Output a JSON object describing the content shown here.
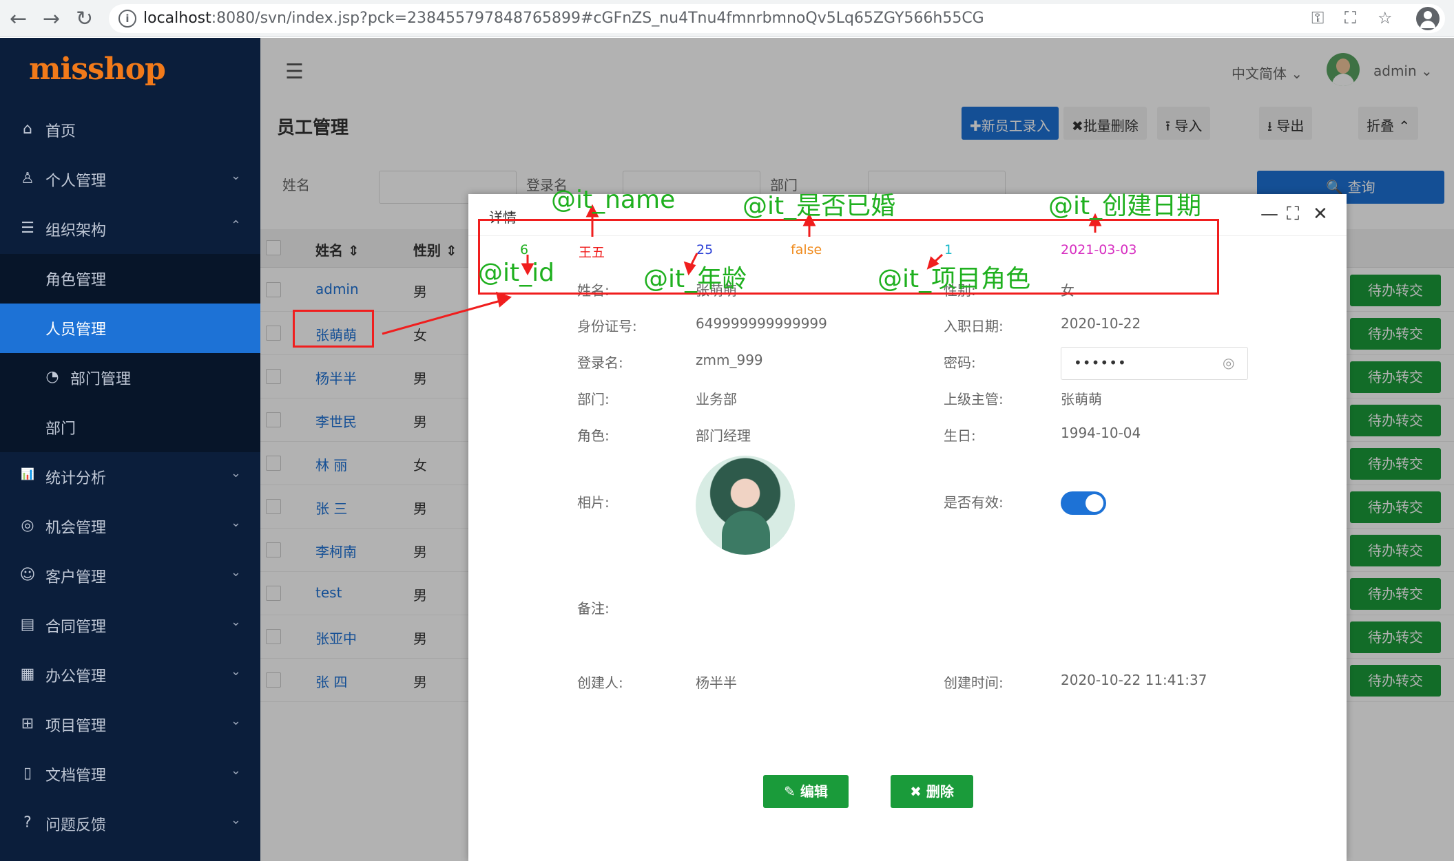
{
  "browser": {
    "url_host": "localhost",
    "url_rest": ":8080/svn/index.jsp?pck=2384557978487658​99#cGFnZS_nu4Tnu4fmnrbmnoQv5Lq65ZGY566h55CG"
  },
  "app": {
    "logo": "misshop"
  },
  "sidebar": {
    "items": [
      {
        "label": "首页",
        "icon": "home-icon",
        "ic": "⌂"
      },
      {
        "label": "个人管理",
        "icon": "user-icon",
        "ic": "♙",
        "chev": "⌄"
      },
      {
        "label": "组织架构",
        "icon": "menu-icon",
        "ic": "☰",
        "chev": "⌃"
      },
      {
        "label": "角色管理"
      },
      {
        "label": "人员管理"
      },
      {
        "label": "部门管理",
        "icon": "pie-icon",
        "ic": "◔"
      },
      {
        "label": "部门"
      },
      {
        "label": "统计分析",
        "icon": "chart-icon",
        "ic": "📊",
        "chev": "⌄"
      },
      {
        "label": "机会管理",
        "icon": "opportunity-icon",
        "ic": "◎",
        "chev": "⌄"
      },
      {
        "label": "客户管理",
        "icon": "customer-icon",
        "ic": "☺",
        "chev": "⌄"
      },
      {
        "label": "合同管理",
        "icon": "contract-icon",
        "ic": "▤",
        "chev": "⌄"
      },
      {
        "label": "办公管理",
        "icon": "calendar-icon",
        "ic": "▦",
        "chev": "⌄"
      },
      {
        "label": "项目管理",
        "icon": "project-icon",
        "ic": "⊞",
        "chev": "⌄"
      },
      {
        "label": "文档管理",
        "icon": "document-icon",
        "ic": "▯",
        "chev": "⌄"
      },
      {
        "label": "问题反馈",
        "icon": "question-icon",
        "ic": "?",
        "chev": "⌄"
      }
    ]
  },
  "topbar": {
    "language": "中文简体 ⌄",
    "username": "admin ⌄"
  },
  "page": {
    "title": "员工管理",
    "buttons": {
      "new": "✚新员工录入",
      "batch_delete": "✖批量删除",
      "import": "⭱ 导入",
      "export": "⭳ 导出",
      "collapse": "折叠 ⌃"
    }
  },
  "filters": {
    "name_label": "姓名",
    "login_label": "登录名",
    "dept_label": "部门",
    "query_button": "🔍 查询"
  },
  "table": {
    "headers": {
      "name": "姓名 ⇕",
      "sex": "性别 ⇕"
    },
    "rows": [
      {
        "name": "admin",
        "sex": "男",
        "action": "待办转交"
      },
      {
        "name": "张萌萌",
        "sex": "女",
        "action": "待办转交"
      },
      {
        "name": "杨半半",
        "sex": "男",
        "action": "待办转交"
      },
      {
        "name": "李世民",
        "sex": "男",
        "action": "待办转交"
      },
      {
        "name": "林 丽",
        "sex": "女",
        "action": "待办转交"
      },
      {
        "name": "张 三",
        "sex": "男",
        "action": "待办转交"
      },
      {
        "name": "李柯南",
        "sex": "男",
        "action": "待办转交"
      },
      {
        "name": "test",
        "sex": "男",
        "action": "待办转交"
      },
      {
        "name": "张亚中",
        "sex": "男",
        "action": "待办转交"
      },
      {
        "name": "张 四",
        "sex": "男",
        "action": "待办转交"
      }
    ]
  },
  "dialog": {
    "title": "详情",
    "it_values": {
      "id": "6",
      "name": "王五",
      "age": "25",
      "married": "false",
      "role": "1",
      "created_date": "2021-03-03"
    },
    "fields": {
      "name_label": "姓名:",
      "name_value": "张萌萌",
      "sex_label": "性别:",
      "sex_value": "女",
      "idcard_label": "身份证号:",
      "idcard_value": "649999999999999",
      "hire_label": "入职日期:",
      "hire_value": "2020-10-22",
      "login_label": "登录名:",
      "login_value": "zmm_999",
      "password_label": "密码:",
      "password_value": "••••••",
      "dept_label": "部门:",
      "dept_value": "业务部",
      "manager_label": "上级主管:",
      "manager_value": "张萌萌",
      "role_label": "角色:",
      "role_value": "部门经理",
      "birthday_label": "生日:",
      "birthday_value": "1994-10-04",
      "photo_label": "相片:",
      "valid_label": "是否有效:",
      "remark_label": "备注:",
      "creator_label": "创建人:",
      "creator_value": "杨半半",
      "created_label": "创建时间:",
      "created_value": "2020-10-22 11:41:37"
    },
    "buttons": {
      "edit": "✎ 编辑",
      "delete": "✖ 删除"
    }
  },
  "annotations": {
    "it_name": "@it_name",
    "it_married": "@it_是否已婚",
    "it_created": "@it_创建日期",
    "it_id": "@it_id",
    "it_age": "@it_年龄",
    "it_role": "@it_项目角色"
  },
  "colors": {
    "accent": "#1d72d6",
    "success": "#1a9b3a",
    "sidebar": "#0b1e3b",
    "annotation_red": "#f01e1e",
    "annotation_green": "#1fb01f"
  }
}
